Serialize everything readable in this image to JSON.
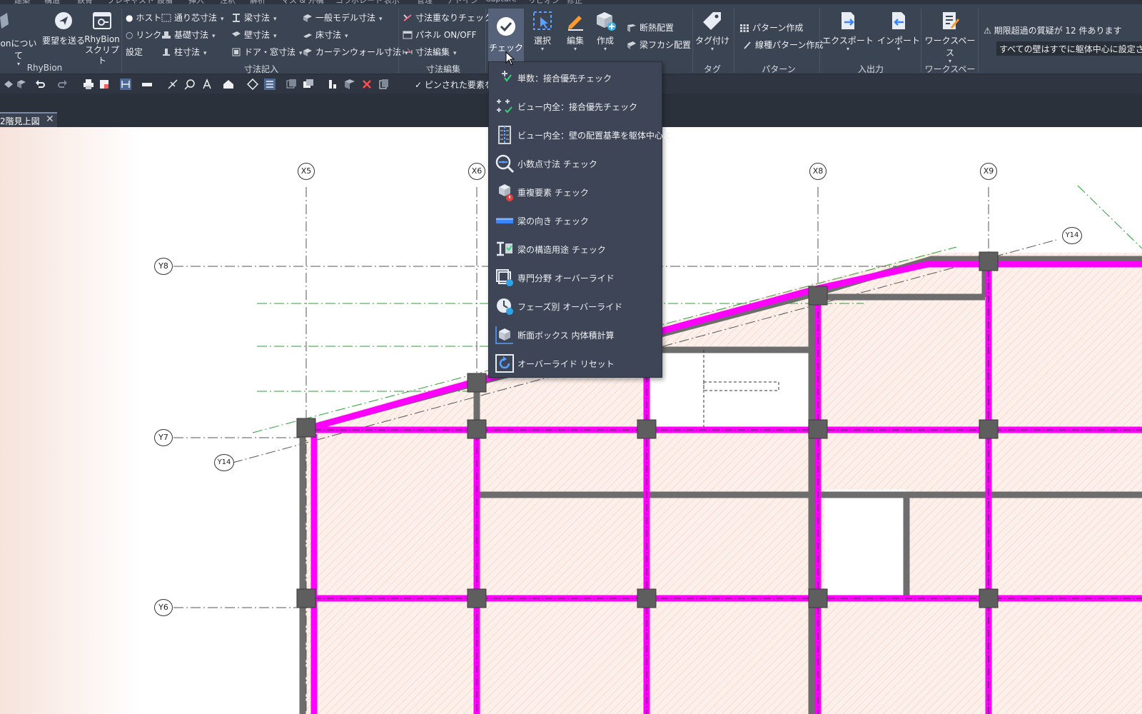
{
  "menubar": {
    "items": [
      "建築",
      "構造",
      "鉄骨",
      "プレキャスト",
      "設備",
      "挿入",
      "注釈",
      "解析",
      "マス & 外構",
      "コラボレート",
      "表示",
      "管理",
      "アドイン",
      "Capture",
      "リビオン",
      "修正"
    ]
  },
  "ribbon": {
    "rhybion": {
      "about_label": "onについて",
      "feedback_label": "要望を送る",
      "script_label_1": "RhyBion",
      "script_label_2": "スクリプト",
      "panel_label": "RhyBion"
    },
    "dim_entry": {
      "host_label": "ホスト",
      "link_label": "リンク",
      "settings_label": "設定",
      "grid_dim_label": "通り芯寸法",
      "found_dim_label": "基礎寸法",
      "col_dim_label": "柱寸法",
      "beam_dim_label": "梁寸法",
      "wall_dim_label": "壁寸法",
      "door_dim_label": "ドア・窓寸法",
      "model_dim_label": "一般モデル寸法",
      "floor_dim_label": "床寸法",
      "curtain_dim_label": "カーテンウォール寸法",
      "panel_label": "寸法記入"
    },
    "dim_edit": {
      "overlap_check_label": "寸法重なりチェック",
      "panel_toggle_label": "パネル ON/OFF",
      "dim_edit_label": "寸法編集",
      "panel_label": "寸法編集"
    },
    "check_label": "チェック",
    "select_label": "選択",
    "edit_label": "編集",
    "create_label": "作成",
    "insulation_label": "断熱配置",
    "beam_fukashi_label": "梁フカシ配置",
    "tag": {
      "tag_label": "タグ付け",
      "panel_label": "タグ"
    },
    "pattern": {
      "create_label": "パターン作成",
      "line_label": "線種パターン作成",
      "panel_label": "パターン"
    },
    "io": {
      "export_label": "エクスポート",
      "import_label": "インポート",
      "panel_label": "入出力"
    },
    "workspace": {
      "label": "ワークスペース",
      "panel_label": "ワークスペース"
    }
  },
  "notifications": {
    "overdue": "期限超過の質疑が 12 件あります",
    "walls": "すべての壁はすでに躯体中心に設定されてい"
  },
  "qat": {
    "pinned_text": "ピンされた要素を選択"
  },
  "tabs": {
    "active_label": "2階見上図"
  },
  "dropdown": {
    "items": [
      "単数：接合優先チェック",
      "ビュー内全：接合優先チェック",
      "ビュー内全：壁の配置基準を躯体中心に",
      "小数点寸法 チェック",
      "重複要素 チェック",
      "梁の向き チェック",
      "梁の構造用途 チェック",
      "専門分野 オーバーライド",
      "フェーズ別 オーバーライド",
      "断面ボックス 内体積計算",
      "オーバーライド リセット"
    ]
  },
  "grid": {
    "x_labels": [
      "X5",
      "X6",
      "X8",
      "X9"
    ],
    "y_labels": [
      "Y8",
      "Y7",
      "Y6"
    ],
    "diag_labels": [
      "Y14",
      "Y14"
    ]
  },
  "colors": {
    "ribbon": "#3b4453",
    "menu": "#3d4556",
    "beam": "#ff00ff",
    "wall": "#6d6d6d",
    "grid_accent": "#2e9e3a",
    "floor_fill": "#fbe9e0"
  }
}
